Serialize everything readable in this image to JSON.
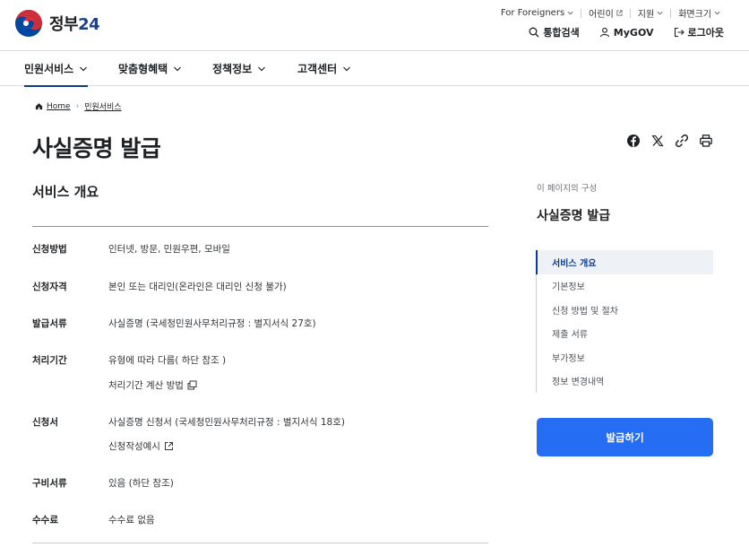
{
  "header": {
    "logo_text": "정부",
    "logo_num": "24",
    "utility": [
      {
        "label": "For Foreigners",
        "icon": "chevron-down-icon"
      },
      {
        "label": "어린이",
        "icon": "external-link-icon"
      },
      {
        "label": "지원",
        "icon": "chevron-down-icon"
      },
      {
        "label": "화면크기",
        "icon": "chevron-down-icon"
      }
    ],
    "actions": [
      {
        "label": "통합검색",
        "icon": "search-icon"
      },
      {
        "label": "MyGOV",
        "icon": "user-icon"
      },
      {
        "label": "로그아웃",
        "icon": "logout-icon"
      }
    ]
  },
  "gnb": [
    {
      "label": "민원서비스"
    },
    {
      "label": "맞춤형혜택"
    },
    {
      "label": "정책정보"
    },
    {
      "label": "고객센터"
    }
  ],
  "breadcrumb": {
    "home": "Home",
    "current": "민원서비스"
  },
  "page_title": "사실증명 발급",
  "share_icons": [
    "facebook-icon",
    "x-icon",
    "link-icon",
    "print-icon"
  ],
  "section_title": "서비스 개요",
  "rows": [
    {
      "label": "신청방법",
      "value": "인터넷, 방문, 민원우편, 모바일"
    },
    {
      "label": "신청자격",
      "value": "본인 또는 대리인(온라인은 대리인 신청 불가)"
    },
    {
      "label": "발급서류",
      "value": "사실증명 (국세청민원사무처리규정 : 별지서식 27호)"
    },
    {
      "label": "처리기간",
      "value": "유형에 따라 다름( 하단 참조 )",
      "link": "처리기간 계산 방법"
    },
    {
      "label": "신청서",
      "value": "사실증명 신청서 (국세청민원사무처리규정 : 별지서식 18호)",
      "link": "신청작성예시"
    },
    {
      "label": "구비서류",
      "value": "있음 (하단 참조)"
    },
    {
      "label": "수수료",
      "value": "수수료 없음"
    }
  ],
  "toc": {
    "caption": "이 페이지의 구성",
    "title": "사실증명 발급",
    "items": [
      "서비스 개요",
      "기본정보",
      "신청 방법 및 절차",
      "제출 서류",
      "부가정보",
      "정보 변경내역"
    ]
  },
  "cta_label": "발급하기",
  "colors": {
    "primary": "#256ef4",
    "navy": "#0b3c8c",
    "logo_red": "#cd2e3a",
    "logo_blue": "#0047a0"
  }
}
